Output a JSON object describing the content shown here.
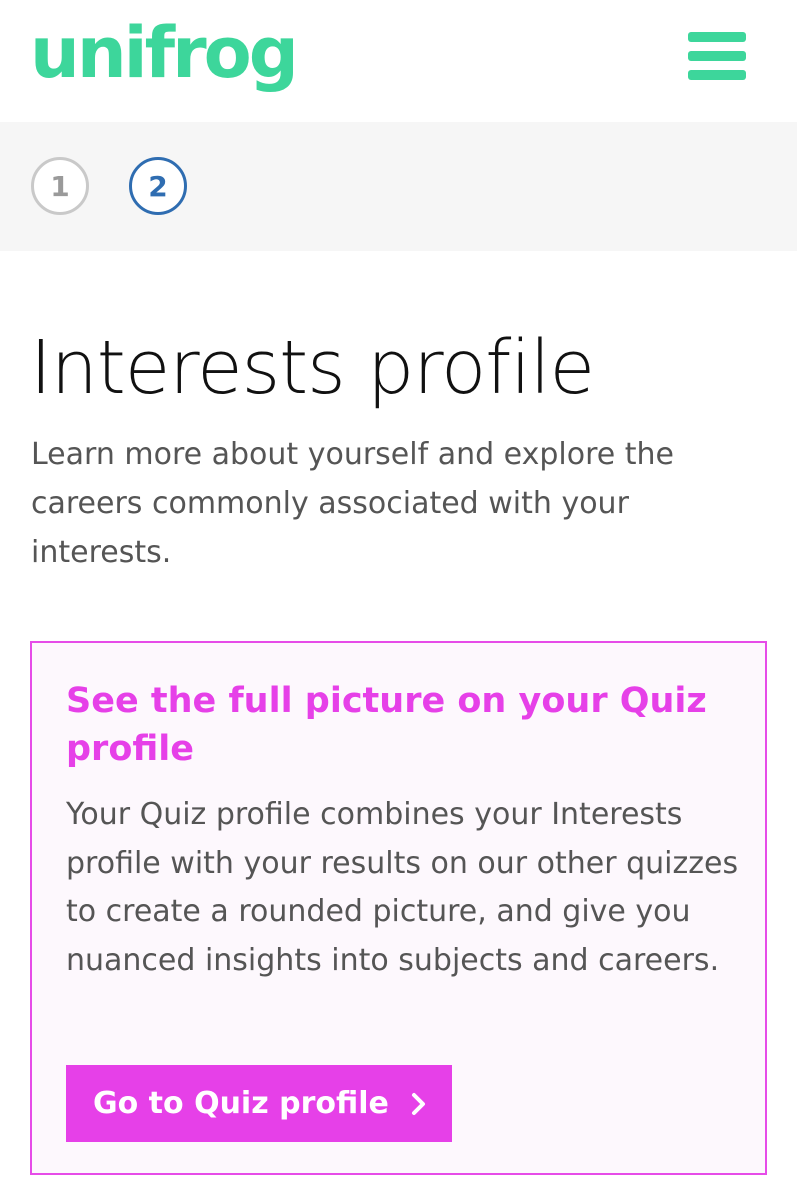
{
  "header": {
    "logo_text": "unifrog",
    "menu_icon": "hamburger-menu-icon"
  },
  "steps": [
    {
      "label": "1",
      "state": "inactive"
    },
    {
      "label": "2",
      "state": "active"
    }
  ],
  "page": {
    "title": "Interests profile",
    "intro": "Learn more about yourself and explore the careers commonly associated with your interests."
  },
  "promo": {
    "title": "See the full picture on your Quiz profile",
    "text": "Your Quiz profile combines your Interests profile with your results on our other quizzes to create a rounded picture, and give you nuanced insights into subjects and careers.",
    "button_label": "Go to Quiz profile",
    "button_icon": "chevron-right-icon"
  },
  "colors": {
    "brand_green": "#3dd69b",
    "step_active": "#2f6db1",
    "step_inactive": "#9a9a9a",
    "accent_magenta": "#e640e8"
  }
}
